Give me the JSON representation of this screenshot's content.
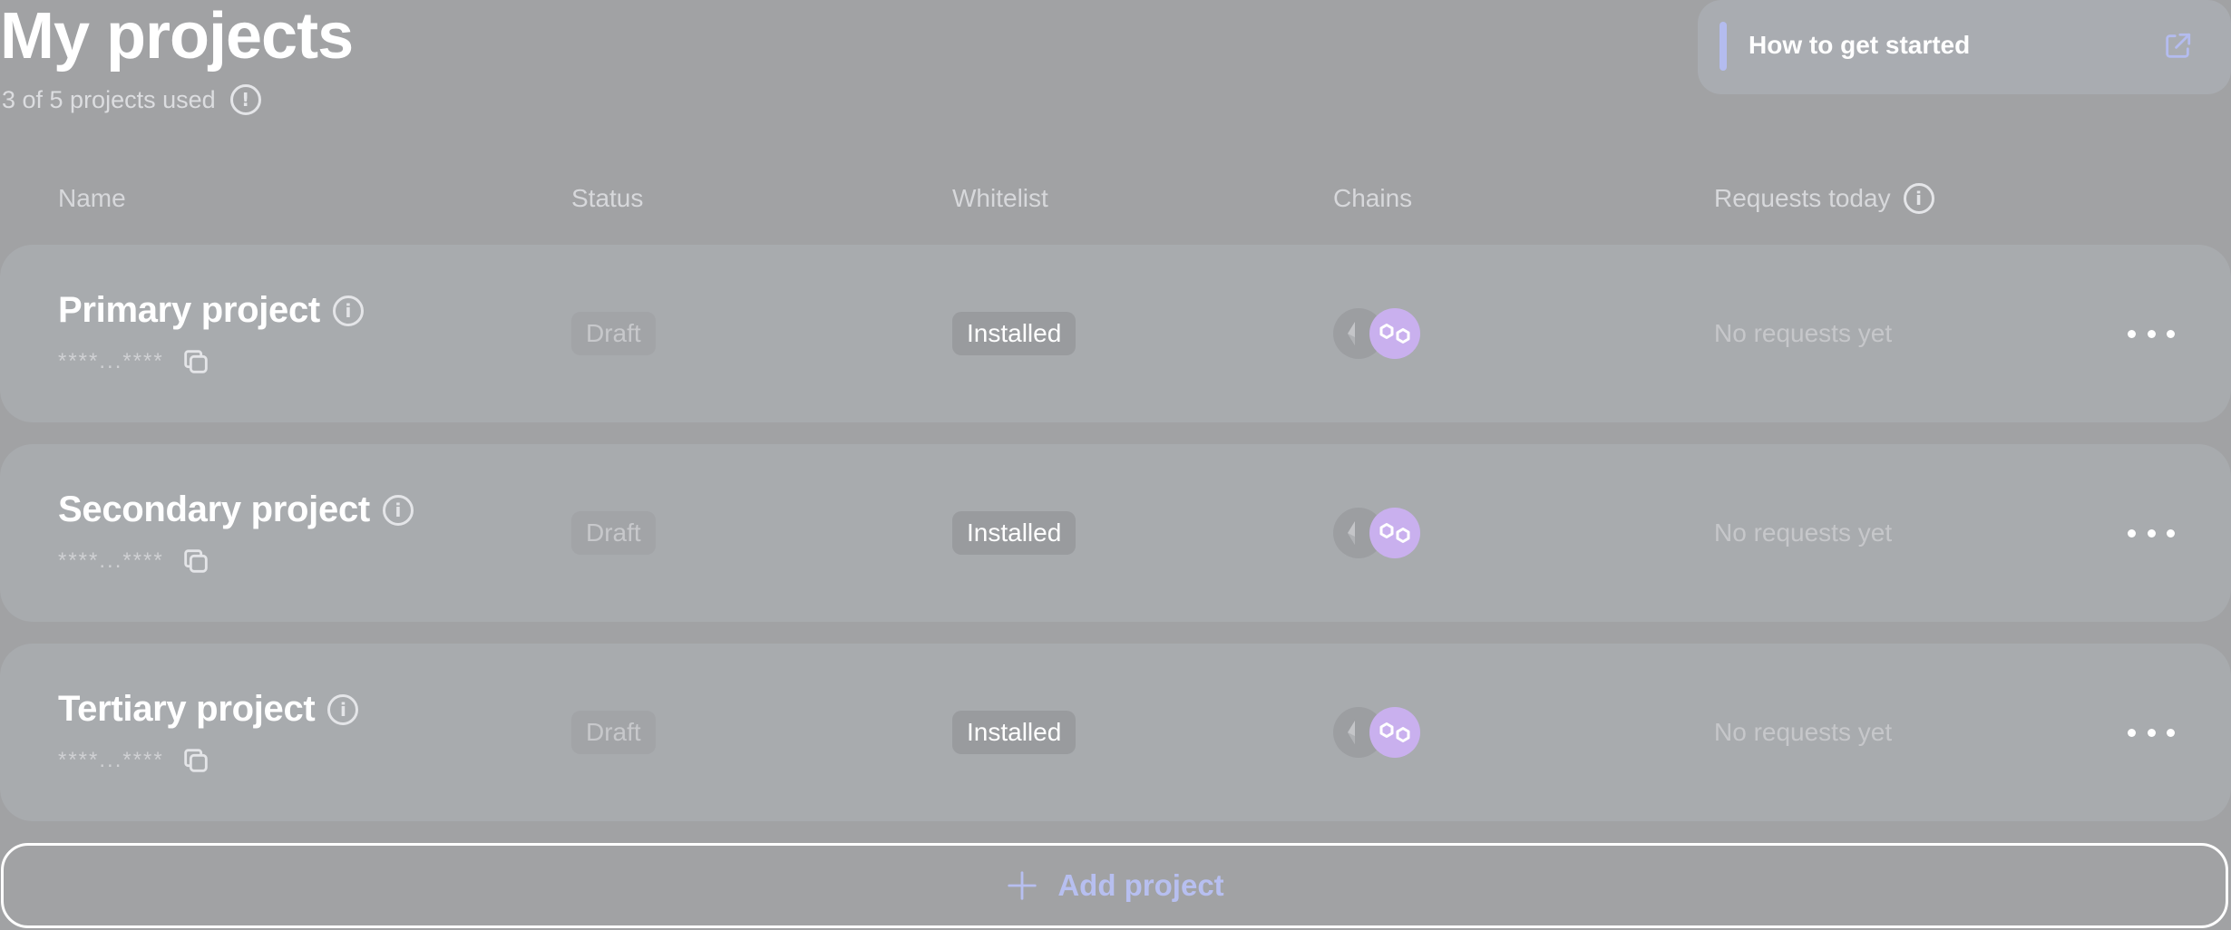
{
  "header": {
    "title": "My projects",
    "usage_text": "3 of 5 projects used",
    "usage_icon": "exclamation-icon"
  },
  "help_card": {
    "label": "How to get started",
    "icon": "external-link-icon"
  },
  "table": {
    "columns": [
      "Name",
      "Status",
      "Whitelist",
      "Chains",
      "Requests today"
    ],
    "rows": [
      {
        "name": "Primary project",
        "key": "****...****",
        "status": "Draft",
        "whitelist": "Installed",
        "chains": [
          "ethereum",
          "polygon"
        ],
        "requests": "No requests yet"
      },
      {
        "name": "Secondary project",
        "key": "****...****",
        "status": "Draft",
        "whitelist": "Installed",
        "chains": [
          "ethereum",
          "polygon"
        ],
        "requests": "No requests yet"
      },
      {
        "name": "Tertiary project",
        "key": "****...****",
        "status": "Draft",
        "whitelist": "Installed",
        "chains": [
          "ethereum",
          "polygon"
        ],
        "requests": "No requests yet"
      }
    ]
  },
  "add_button": {
    "label": "Add project",
    "icon": "plus-icon"
  },
  "colors": {
    "background": "#a1a2a4",
    "row_background": "#a8abae",
    "accent": "#b4bcef",
    "polygon": "#c9b0ee",
    "text_primary": "#ffffff"
  }
}
